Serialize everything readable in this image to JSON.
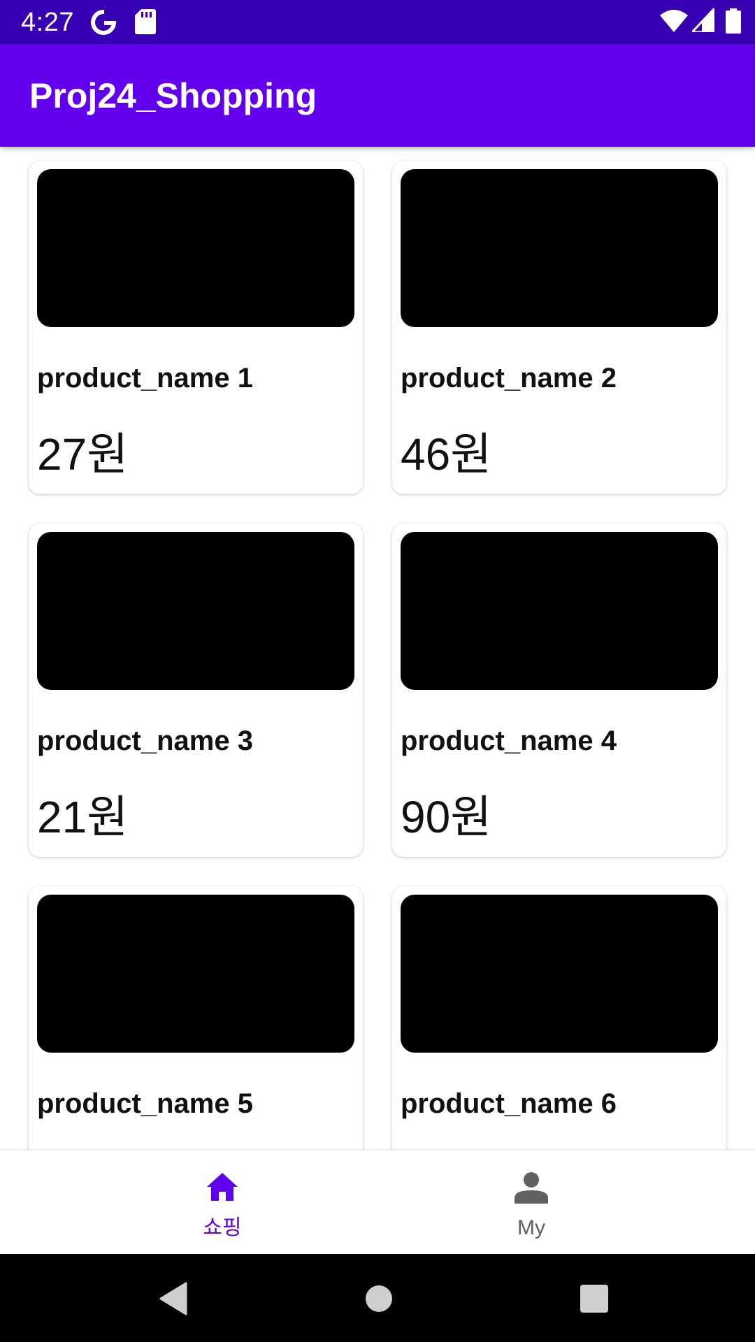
{
  "status_bar": {
    "time": "4:27",
    "icons": [
      "google-g-icon",
      "sd-card-icon",
      "wifi-icon",
      "cell-signal-icon",
      "battery-icon"
    ],
    "background": "#3700b3"
  },
  "app_bar": {
    "title": "Proj24_Shopping",
    "background": "#6200ee"
  },
  "products": [
    {
      "name": "product_name 1",
      "price": "27원"
    },
    {
      "name": "product_name 2",
      "price": "46원"
    },
    {
      "name": "product_name 3",
      "price": "21원"
    },
    {
      "name": "product_name 4",
      "price": "90원"
    },
    {
      "name": "product_name 5",
      "price": ""
    },
    {
      "name": "product_name 6",
      "price": ""
    }
  ],
  "bottom_nav": {
    "items": [
      {
        "label": "쇼핑",
        "icon": "home-icon",
        "active": true
      },
      {
        "label": "My",
        "icon": "person-icon",
        "active": false
      }
    ],
    "active_color": "#6200ee",
    "inactive_color": "#616161"
  },
  "system_nav": {
    "buttons": [
      "back-icon",
      "home-circle-icon",
      "recents-icon"
    ]
  }
}
